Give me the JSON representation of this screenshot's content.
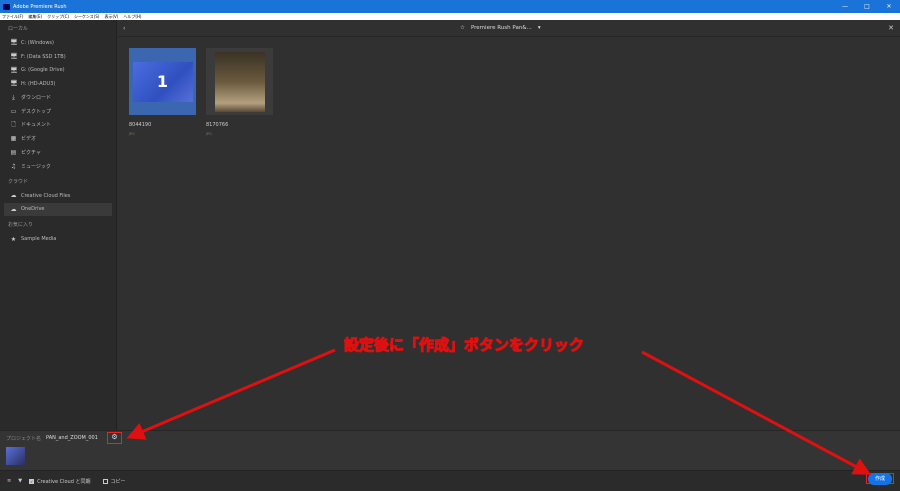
{
  "app": {
    "title": "Adobe Premiere Rush"
  },
  "menu": [
    "ファイル(F)",
    "編集(E)",
    "クリップ(C)",
    "シーケンス(S)",
    "表示(V)",
    "ヘルプ(H)"
  ],
  "sidebar": {
    "local_label": "ローカル",
    "local": [
      {
        "icon": "monitor-icon",
        "label": "C: (Windows)"
      },
      {
        "icon": "monitor-icon",
        "label": "F: (Data SSD 1TB)"
      },
      {
        "icon": "monitor-icon",
        "label": "G: (Google Drive)"
      },
      {
        "icon": "monitor-icon",
        "label": "H: (HD-ADU3)"
      },
      {
        "icon": "download-icon",
        "label": "ダウンロード"
      },
      {
        "icon": "desktop-icon",
        "label": "デスクトップ"
      },
      {
        "icon": "document-icon",
        "label": "ドキュメント"
      },
      {
        "icon": "film-icon",
        "label": "ビデオ"
      },
      {
        "icon": "picture-icon",
        "label": "ピクチャ"
      },
      {
        "icon": "music-icon",
        "label": "ミュージック"
      }
    ],
    "cloud_label": "クラウド",
    "cloud": [
      {
        "icon": "creative-cloud-icon",
        "label": "Creative Cloud Files"
      },
      {
        "icon": "cloud-icon",
        "label": "OneDrive"
      }
    ],
    "fav_label": "お気に入り",
    "fav": [
      {
        "icon": "star-icon",
        "label": "Sample Media"
      }
    ]
  },
  "topbar": {
    "folder": "Premiere Rush Pan&..."
  },
  "files": [
    {
      "name": "8044190",
      "type": "JPG",
      "selected_index": "1"
    },
    {
      "name": "8170766",
      "type": "JPG"
    }
  ],
  "project": {
    "label": "プロジェクト名",
    "name": "PAN_and_ZOOM_001"
  },
  "bottom": {
    "sync_label": "Creative Cloud と同期",
    "copy_label": "コピー",
    "create_label": "作成"
  },
  "annotation": "設定後に「作成」ボタンをクリック",
  "colors": {
    "accent": "#1473e6",
    "annotation": "#e01010",
    "titlebar": "#1a73d9"
  }
}
